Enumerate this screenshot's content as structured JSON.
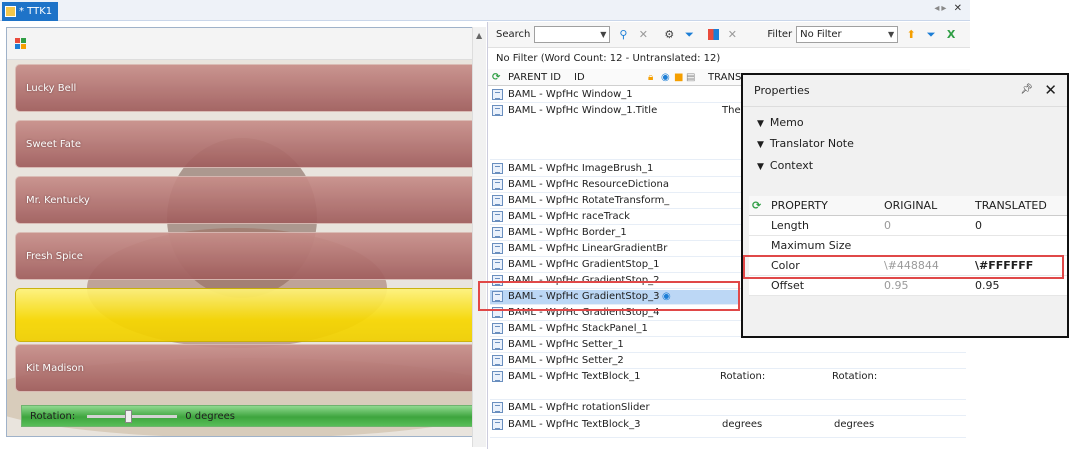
{
  "tab": {
    "label": "* TTK1"
  },
  "preview": {
    "horses": [
      "Lucky Bell",
      "Sweet Fate",
      "Mr. Kentucky",
      "Fresh Spice",
      "",
      "Kit Madison"
    ],
    "rotation_label": "Rotation:",
    "rotation_value": "0 degrees"
  },
  "toolbar": {
    "search_label": "Search",
    "search_value": "",
    "filter_label": "Filter",
    "filter_value": "No Filter"
  },
  "status": "No Filter (Word Count: 12 - Untranslated: 12)",
  "grid": {
    "headers": {
      "parent_id": "PARENT ID",
      "id": "ID",
      "translation": "TRANSL"
    },
    "rows": [
      {
        "parent": "BAML - WpfHc",
        "id": "Window_1",
        "c1": "",
        "c2": ""
      },
      {
        "parent": "BAML - WpfHc",
        "id": "Window_1.Title",
        "c1": "The",
        "c2": ""
      },
      {
        "parent": "BAML - WpfHc",
        "id": "ImageBrush_1",
        "c1": "",
        "c2": ""
      },
      {
        "parent": "BAML - WpfHc",
        "id": "ResourceDictiona",
        "c1": "",
        "c2": ""
      },
      {
        "parent": "BAML - WpfHc",
        "id": "RotateTransform_",
        "c1": "",
        "c2": ""
      },
      {
        "parent": "BAML - WpfHc",
        "id": "raceTrack",
        "c1": "",
        "c2": ""
      },
      {
        "parent": "BAML - WpfHc",
        "id": "Border_1",
        "c1": "",
        "c2": ""
      },
      {
        "parent": "BAML - WpfHc",
        "id": "LinearGradientBr",
        "c1": "",
        "c2": ""
      },
      {
        "parent": "BAML - WpfHc",
        "id": "GradientStop_1",
        "c1": "",
        "c2": ""
      },
      {
        "parent": "BAML - WpfHc",
        "id": "GradientStop_2",
        "c1": "",
        "c2": ""
      },
      {
        "parent": "BAML - WpfHc",
        "id": "GradientStop_3",
        "c1": "",
        "c2": ""
      },
      {
        "parent": "BAML - WpfHc",
        "id": "GradientStop_4",
        "c1": "",
        "c2": ""
      },
      {
        "parent": "BAML - WpfHc",
        "id": "StackPanel_1",
        "c1": "",
        "c2": ""
      },
      {
        "parent": "BAML - WpfHc",
        "id": "Setter_1",
        "c1": "",
        "c2": ""
      },
      {
        "parent": "BAML - WpfHc",
        "id": "Setter_2",
        "c1": "",
        "c2": ""
      },
      {
        "parent": "BAML - WpfHc",
        "id": "TextBlock_1",
        "c1": "Rotation:",
        "c2": "Rotation:"
      },
      {
        "parent": "BAML - WpfHc",
        "id": "rotationSlider",
        "c1": "",
        "c2": ""
      },
      {
        "parent": "BAML - WpfHc",
        "id": "TextBlock_3",
        "c1": "degrees",
        "c2": "degrees"
      }
    ]
  },
  "properties": {
    "title": "Properties",
    "sections": [
      "Memo",
      "Translator Note",
      "Context"
    ],
    "headers": {
      "property": "PROPERTY",
      "original": "ORIGINAL",
      "translated": "TRANSLATED"
    },
    "rows": [
      {
        "property": "Length",
        "original": "0",
        "translated": "0"
      },
      {
        "property": "Maximum Size",
        "original": "",
        "translated": ""
      },
      {
        "property": "Color",
        "original": "\\#448844",
        "translated": "\\#FFFFFF"
      },
      {
        "property": "Offset",
        "original": "0.95",
        "translated": "0.95"
      }
    ]
  },
  "colors": {
    "accent": "#1e73c8",
    "highlight": "#e04848",
    "selection": "#bcd7f5",
    "race_green": "#3ea53e"
  }
}
